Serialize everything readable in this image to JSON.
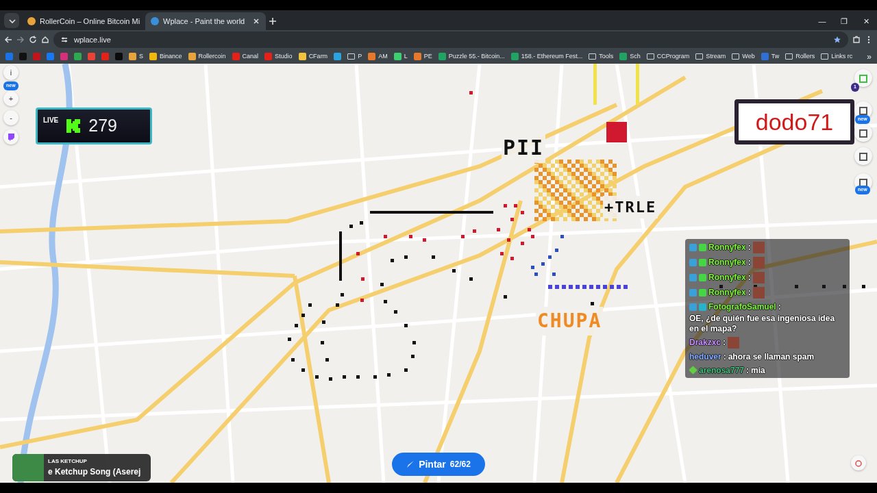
{
  "window": {
    "controls": [
      "—",
      "❐",
      "✕"
    ]
  },
  "tabs": [
    {
      "title": "RollerCoin – Online Bitcoin Mi",
      "selected": false,
      "color": "#e8a33a"
    },
    {
      "title": "Wplace - Paint the world",
      "selected": true,
      "color": "#3a8fd8"
    }
  ],
  "address": "wplace.live",
  "bookmarks": [
    {
      "kind": "site",
      "color": "#1a73e8"
    },
    {
      "kind": "site",
      "color": "#111111"
    },
    {
      "kind": "site",
      "color": "#c4141b"
    },
    {
      "kind": "site",
      "color": "#1877f2"
    },
    {
      "kind": "site",
      "color": "#d6307a"
    },
    {
      "kind": "site",
      "color": "#2da94f"
    },
    {
      "kind": "site",
      "color": "#ea4335"
    },
    {
      "kind": "site",
      "color": "#e62117"
    },
    {
      "kind": "site",
      "color": "#0b0b0b"
    },
    {
      "kind": "site",
      "color": "#e8a33a",
      "label": "S"
    },
    {
      "kind": "site",
      "color": "#f0b90b",
      "label": "Binance"
    },
    {
      "kind": "site",
      "color": "#e8a33a",
      "label": "Rollercoin"
    },
    {
      "kind": "site",
      "color": "#e62117",
      "label": "Canal"
    },
    {
      "kind": "site",
      "color": "#e62117",
      "label": "Studio"
    },
    {
      "kind": "site",
      "color": "#f2c33c",
      "label": "CFarm"
    },
    {
      "kind": "site",
      "color": "#2aa3df"
    },
    {
      "kind": "folder",
      "label": "P"
    },
    {
      "kind": "site",
      "color": "#e8782a",
      "label": "AM"
    },
    {
      "kind": "site",
      "color": "#3bd16f",
      "label": "L"
    },
    {
      "kind": "site",
      "color": "#e8782a",
      "label": "PE"
    },
    {
      "kind": "site",
      "color": "#1fa463",
      "label": "Puzzle 55.- Bitcoin..."
    },
    {
      "kind": "site",
      "color": "#1fa463",
      "label": "158.- Ethereum Fest..."
    },
    {
      "kind": "folder",
      "label": "Tools"
    },
    {
      "kind": "site",
      "color": "#1fa463",
      "label": "Sch"
    },
    {
      "kind": "folder",
      "label": "CCProgram"
    },
    {
      "kind": "folder",
      "label": "Stream"
    },
    {
      "kind": "folder",
      "label": "Web"
    },
    {
      "kind": "site",
      "color": "#2f6fd6",
      "label": "Tw"
    },
    {
      "kind": "folder",
      "label": "Rollers"
    },
    {
      "kind": "folder",
      "label": "Links rc"
    }
  ],
  "bookmarks_more": "»",
  "left_controls": {
    "info": "i",
    "info_badge": "new",
    "zoom_in": "+",
    "zoom_out": "-"
  },
  "live_widget": {
    "label": "LIVE",
    "count": "279"
  },
  "name_plate": "dodo71",
  "right_controls": {
    "notification_count": "1",
    "shop_badge": "new",
    "stats_badge": "new"
  },
  "map_art": [
    {
      "text": "PII",
      "color": "#111111"
    },
    {
      "text": "+TRLE",
      "color": "#111111"
    },
    {
      "text": "CHUPA",
      "color": "#f08a24"
    }
  ],
  "chat": [
    {
      "user": "Ronnyfex",
      "color": "#7cf03a",
      "separator": ":",
      "emote": true
    },
    {
      "user": "Ronnyfex",
      "color": "#7cf03a",
      "separator": ":",
      "emote": true
    },
    {
      "user": "Ronnyfex",
      "color": "#7cf03a",
      "separator": ":",
      "emote": true
    },
    {
      "user": "Ronnyfex",
      "color": "#7cf03a",
      "separator": ":",
      "emote": true
    },
    {
      "user": "FotografoSamuel",
      "color": "#7cf03a",
      "separator": ":",
      "text": "OE, ¿de quién fue esa ingeniosa idea en el mapa?",
      "emote": false
    },
    {
      "user": "Drakzxc",
      "color": "#c58cff",
      "separator": ":",
      "emote": true
    },
    {
      "user": "heduver",
      "color": "#7fa8ff",
      "separator": ":",
      "text": "ahora se llaman spam",
      "emote": false
    },
    {
      "user": "arenosa777",
      "color": "#3fbf7a",
      "separator": ":",
      "text": "mia",
      "emote": false
    }
  ],
  "now_playing": {
    "artist": "LAS KETCHUP",
    "title": "e Ketchup Song (Aserej"
  },
  "paint_button": {
    "label": "Pintar",
    "charges": "62/62"
  }
}
